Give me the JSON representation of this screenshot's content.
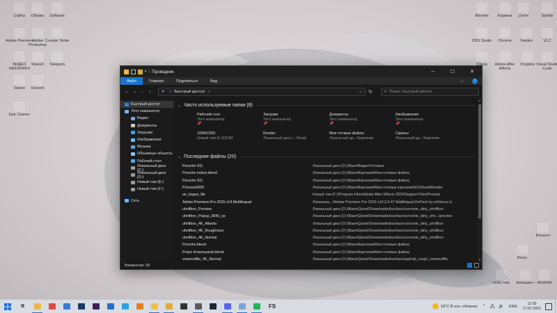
{
  "desktop_icons": [
    {
      "label": "Сайты",
      "icon": "folder-icon"
    },
    {
      "label": "Облако",
      "icon": "folder-icon"
    },
    {
      "label": "Software",
      "icon": "folder-icon"
    },
    {
      "label": "Adobe Premiere",
      "icon": "app-icon"
    },
    {
      "label": "Adobe Photoshop",
      "icon": "app-icon"
    },
    {
      "label": "Counter Strike",
      "icon": "game-icon"
    },
    {
      "label": "ВИДЕО МАТЕРИАЛ",
      "icon": "folder-icon"
    },
    {
      "label": "ShareX",
      "icon": "app-icon"
    },
    {
      "label": "Telegram",
      "icon": "app-icon"
    },
    {
      "label": "Steam",
      "icon": "app-icon"
    },
    {
      "label": "Discord",
      "icon": "app-icon"
    },
    {
      "label": "Epic Games",
      "icon": "app-icon"
    },
    {
      "label": "Blender",
      "icon": "app-icon"
    },
    {
      "label": "Корзина",
      "icon": "recycle-bin-icon"
    },
    {
      "label": "Zoom",
      "icon": "app-icon"
    },
    {
      "label": "Spotify",
      "icon": "app-icon"
    },
    {
      "label": "OBS Studio",
      "icon": "app-icon"
    },
    {
      "label": "Chrome",
      "icon": "app-icon"
    },
    {
      "label": "Yandex",
      "icon": "app-icon"
    },
    {
      "label": "VLC",
      "icon": "app-icon"
    },
    {
      "label": "Opera",
      "icon": "app-icon"
    },
    {
      "label": "Adobe After Effects",
      "icon": "app-icon"
    },
    {
      "label": "Dropbox",
      "icon": "app-icon"
    },
    {
      "label": "Visual Studio Code",
      "icon": "app-icon"
    },
    {
      "label": "Блокнот",
      "icon": "app-icon"
    },
    {
      "label": "Вегас",
      "icon": "app-icon"
    },
    {
      "label": "Unity Hub",
      "icon": "app-icon"
    },
    {
      "label": "Notepad++",
      "icon": "app-icon"
    },
    {
      "label": "WinRAR",
      "icon": "app-icon"
    }
  ],
  "window": {
    "title": "Проводник",
    "ribbon_tabs": [
      "Файл",
      "Главная",
      "Поделиться",
      "Вид"
    ],
    "address": {
      "root": "Быстрый доступ",
      "separator": ">"
    },
    "search_placeholder": "Поиск: Быстрый доступ",
    "status": "Элементов: 28",
    "sidebar": [
      {
        "label": "Быстрый доступ",
        "level": "top",
        "color": "#2f87e0"
      },
      {
        "label": "Этот компьютер",
        "level": "l1",
        "color": "#6fb8ff"
      },
      {
        "label": "Видео",
        "level": "l2",
        "color": "#6aa9e8"
      },
      {
        "label": "Документы",
        "level": "l2",
        "color": "#c9c9c9"
      },
      {
        "label": "Загрузки",
        "level": "l2",
        "color": "#3f9de9"
      },
      {
        "label": "Изображения",
        "level": "l2",
        "color": "#73b6ea"
      },
      {
        "label": "Музыка",
        "level": "l2",
        "color": "#4fa3e6"
      },
      {
        "label": "Объемные объекты",
        "level": "l2",
        "color": "#8bc4f0"
      },
      {
        "label": "Рабочий стол",
        "level": "l2",
        "color": "#5aa8ea"
      },
      {
        "label": "Локальный диск (C:)",
        "level": "l2",
        "color": "#9a9a9a"
      },
      {
        "label": "Локальный диск (D:)",
        "level": "l2",
        "color": "#9a9a9a"
      },
      {
        "label": "Новый том (E:)",
        "level": "l2",
        "color": "#9a9a9a"
      },
      {
        "label": "Новый том (F:)",
        "level": "l2",
        "color": "#9a9a9a"
      },
      {
        "label": "Сеть",
        "level": "l1gap",
        "color": "#6fb8ff"
      }
    ],
    "frequent": {
      "heading": "Часто используемые папки (8)",
      "tiles": [
        {
          "name": "Рабочий стол",
          "sub": "Этот компьютер",
          "pinned": true
        },
        {
          "name": "Загрузки",
          "sub": "Этот компьютер",
          "pinned": true
        },
        {
          "name": "Документы",
          "sub": "Этот компьютер",
          "pinned": true
        },
        {
          "name": "Изображения",
          "sub": "Этот компьютер",
          "pinned": true
        },
        {
          "name": "100NCD50",
          "sub": "Новый том (F:)\\DCIM",
          "pinned": false
        },
        {
          "name": "Render",
          "sub": "Локальный диск (...\\Road",
          "pinned": false
        },
        {
          "name": "Мои готовые файлы",
          "sub": "Локальный ди...\\Картинки",
          "pinned": false
        },
        {
          "name": "Скрины",
          "sub": "Локальный ди...\\Картинки",
          "pinned": false
        }
      ]
    },
    "recent": {
      "heading": "Последние файлы (20)",
      "files": [
        {
          "name": "Porsche 911",
          "path": "Локальный диск (D:)\\Ваня\\Видео\\Готовые"
        },
        {
          "name": "Porsche indoor.blend",
          "path": "Локальный диск (D:)\\Ваня\\Картинки\\Мои готовые файлы"
        },
        {
          "name": "Porsche 911",
          "path": "Локальный диск (D:)\\Ваня\\Картинки\\Мои готовые файлы"
        },
        {
          "name": "Pictures0000",
          "path": "Локальный диск (D:)\\Ваня\\Картинки\\Мои готовые картинки\\911\\Road\\Render"
        },
        {
          "name": "ae_bogus_file",
          "path": "Новый том (F:)\\Program Files\\Adobe After Effects 2020\\Support Files\\Presets"
        },
        {
          "name": "Adobe.Premiere.Pro.2020.v14.Multilingual",
          "path": "Локальны...\\Adobe Premiere Pro 2020 v14.2.0.47 Multilingual RePack by m0nkrus (x64)"
        },
        {
          "name": "uhnlfbvn_Preview",
          "path": "Локальный диск (D:)\\Ваня\\Quixel\\Downloaded\\surface\\concrete_dirty_uhnlfbvn"
        },
        {
          "name": "uhnlfbvn_Popup_3840_sp",
          "path": "Локальный диск (D:)\\Ваня\\Quixel\\Downloaded\\surface\\concrete_dirty_uhn...\\previews"
        },
        {
          "name": "uhnlfbvn_4K_Albedo",
          "path": "Локальный диск (D:)\\Ваня\\Quixel\\Downloaded\\surface\\concrete_dirty_uhnlfbvn"
        },
        {
          "name": "uhnlfbvn_4K_Roughness",
          "path": "Локальный диск (D:)\\Ваня\\Quixel\\Downloaded\\surface\\concrete_dirty_uhnlfbvn"
        },
        {
          "name": "uhnlfbvn_4K_Normal",
          "path": "Локальный диск (D:)\\Ваня\\Quixel\\Downloaded\\surface\\concrete_dirty_uhnlfbvn"
        },
        {
          "name": "Porsche.blend",
          "path": "Локальный диск (D:)\\Ваня\\Картинки\\Мои готовые файлы"
        },
        {
          "name": "Propo Krasnoyarsk.blend",
          "path": "Локальный диск (D:)\\Ваня\\Картинки\\Мои готовые файлы"
        },
        {
          "name": "vewmcdffw_4K_Normal",
          "path": "Локальный диск (D:)\\Ваня\\Quixel\\Downloaded\\surface\\asphalt_rough_vewmcdffw"
        }
      ]
    }
  },
  "taskbar": {
    "apps": [
      {
        "name": "explorer",
        "color": "#e8b84a",
        "active": true
      },
      {
        "name": "chrome",
        "color": "#e0493b",
        "active": false
      },
      {
        "name": "store",
        "color": "#3a7bd5",
        "active": false
      },
      {
        "name": "photoshop",
        "color": "#1a3a66",
        "active": false
      },
      {
        "name": "premiere",
        "color": "#3b1f5e",
        "active": false
      },
      {
        "name": "mail",
        "color": "#2a6dc8",
        "active": false
      },
      {
        "name": "telegram",
        "color": "#2aa3e0",
        "active": false
      },
      {
        "name": "blender",
        "color": "#e57d22",
        "active": false
      },
      {
        "name": "explorer2",
        "color": "#f0c040",
        "active": true
      },
      {
        "name": "explorer3",
        "color": "#e6a83a",
        "active": true
      },
      {
        "name": "obs",
        "color": "#333333",
        "active": false
      },
      {
        "name": "settings",
        "color": "#5c5c5c",
        "active": true
      },
      {
        "name": "steam",
        "color": "#1b2838",
        "active": false
      },
      {
        "name": "discord",
        "color": "#5865f2",
        "active": true
      },
      {
        "name": "notepad",
        "color": "#7aa6d6",
        "active": true
      },
      {
        "name": "spotify",
        "color": "#1db954",
        "active": true
      }
    ],
    "fs_label": "FS",
    "weather": "19°C  В осн. облачно",
    "lang": "ENG",
    "time": "12:30",
    "date": "17.07.2021"
  }
}
